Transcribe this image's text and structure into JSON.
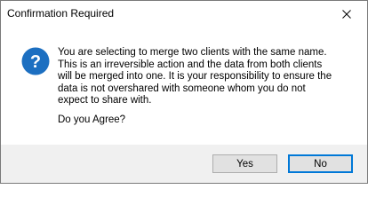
{
  "dialog": {
    "title": "Confirmation Required",
    "close_icon": "close-icon",
    "status_icon": "question-icon",
    "message": "You are selecting to merge two clients with the same name.\nThis is an irreversible action and the data from both clients\nwill be merged into one. It is your responsibility to ensure the\ndata is not overshared with someone whom you do not\nexpect to share with.",
    "question": "Do you Agree?",
    "buttons": {
      "yes_label": "Yes",
      "no_label": "No"
    }
  },
  "colors": {
    "icon_blue": "#1c6fc1",
    "footer_bg": "#f0f0f0",
    "focus_border": "#0078d7"
  }
}
